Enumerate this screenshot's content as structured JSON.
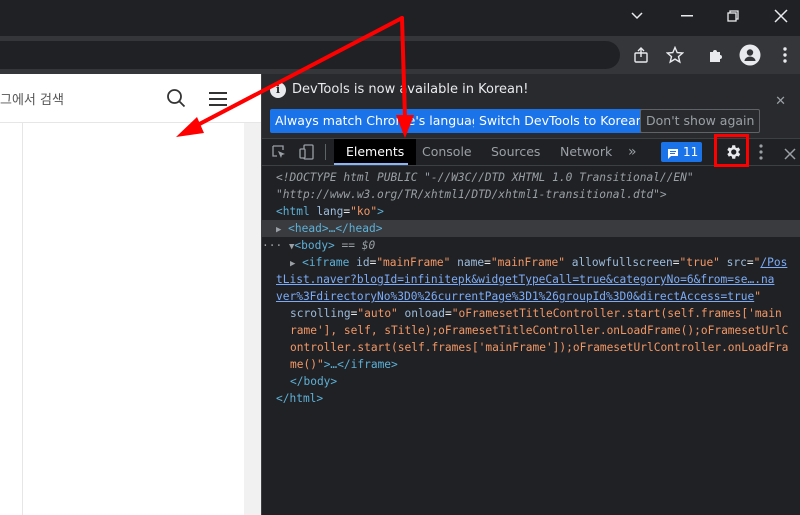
{
  "page": {
    "search_placeholder": "그에서 검색"
  },
  "devtools": {
    "infobar": {
      "message": "DevTools is now available in Korean!",
      "buttons": [
        "Always match Chrome's language",
        "Switch DevTools to Korean",
        "Don't show again"
      ]
    },
    "tabs": [
      "Elements",
      "Console",
      "Sources",
      "Network"
    ],
    "more_tabs": "»",
    "issues_count": "11",
    "dom": {
      "doctype_line1": "<!DOCTYPE html PUBLIC \"-//W3C//DTD XHTML 1.0 Transitional//EN\"",
      "doctype_line2": "\"http://www.w3.org/TR/xhtml1/DTD/xhtml1-transitional.dtd\">",
      "html_open": "<html",
      "html_attr": "lang",
      "html_val": "\"ko\"",
      "head": "<head>…</head>",
      "body_open": "<body>",
      "selected_marker": "== $0",
      "iframe": {
        "tag": "<iframe",
        "id_attr": "id",
        "id_val": "\"mainFrame\"",
        "name_attr": "name",
        "name_val": "\"mainFrame\"",
        "allow_attr": "allowfullscreen",
        "allow_val": "\"true\"",
        "src_attr": "src",
        "src_start": "\"",
        "src_line1": "/Pos",
        "src_line2": "tList.naver?blogId=infinitepk&widgetTypeCall=true&categoryNo=6&from=se….na",
        "src_line3": "ver%3FdirectoryNo%3D0%26currentPage%3D1%26groupId%3D0&directAccess=true",
        "src_end": "\"",
        "scrolling_attr": "scrolling",
        "scrolling_val": "\"auto\"",
        "onload_attr": "onload",
        "onload_line1": "\"oFramesetTitleController.start(self.frames['main",
        "onload_line2": "rame'], self, sTitle);oFramesetTitleController.onLoadFrame();oFramesetUrlC",
        "onload_line3": "ontroller.start(self.frames['mainFrame']);oFramesetUrlController.onLoadFra",
        "onload_line4": "me()\"",
        "close": ">…</iframe>"
      },
      "body_close": "</body>",
      "html_close": "</html>"
    }
  },
  "colors": {
    "accent": "#1a73e8",
    "annotation": "#ff0000"
  }
}
